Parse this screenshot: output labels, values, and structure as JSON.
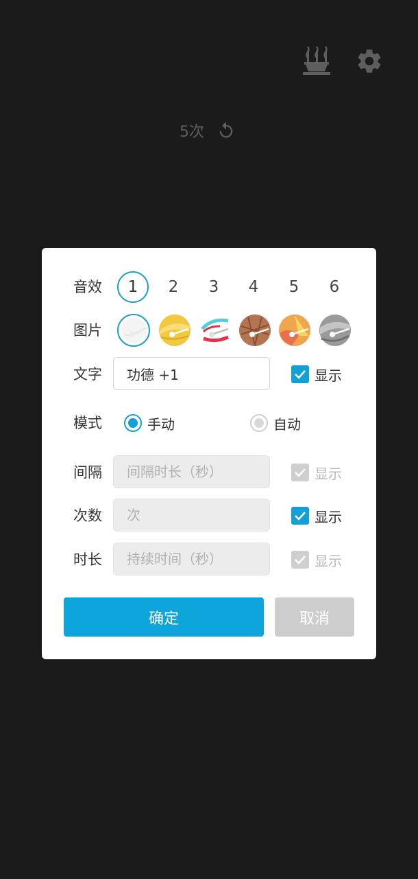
{
  "top_bar": {
    "incense_icon": "incense-burner-icon",
    "settings_icon": "gear-icon"
  },
  "counter": {
    "text": "5次",
    "reset_icon": "reset-icon"
  },
  "dialog": {
    "sound": {
      "label": "音效",
      "options": [
        "1",
        "2",
        "3",
        "4",
        "5",
        "6"
      ],
      "selected": "1"
    },
    "image": {
      "label": "图片",
      "options": [
        "white-woodfish",
        "yellow-woodfish",
        "red-cyan-woodfish",
        "brown-woodfish",
        "orange-woodfish",
        "grey-woodfish"
      ],
      "selected": "white-woodfish"
    },
    "text": {
      "label": "文字",
      "value": "功德 +1",
      "show_label": "显示",
      "show_checked": true
    },
    "mode": {
      "label": "模式",
      "manual_label": "手动",
      "auto_label": "自动",
      "selected": "manual"
    },
    "interval": {
      "label": "间隔",
      "placeholder": "间隔时长（秒）",
      "show_label": "显示",
      "show_checked": true,
      "disabled": true
    },
    "count": {
      "label": "次数",
      "placeholder": "次",
      "show_label": "显示",
      "show_checked": true
    },
    "duration": {
      "label": "时长",
      "placeholder": "持续时间（秒）",
      "show_label": "显示",
      "show_checked": true,
      "disabled": true
    },
    "confirm_label": "确定",
    "cancel_label": "取消"
  },
  "colors": {
    "background": "#1b1b1b",
    "accent": "#0ea5dd",
    "disabled": "#cdcdcd"
  }
}
